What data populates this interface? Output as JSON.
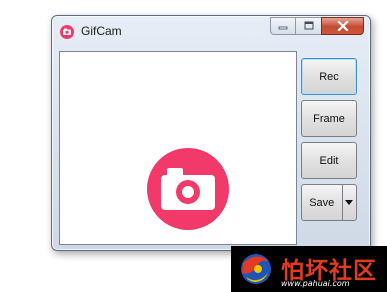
{
  "window": {
    "title": "GifCam",
    "icon": "gifcam-camera-icon",
    "accent_color": "#f23a6a",
    "controls": {
      "minimize_icon": "minimize-icon",
      "maximize_icon": "maximize-icon",
      "close_icon": "close-icon"
    }
  },
  "capture_area": {
    "logo_icon": "camera-icon",
    "logo_color": "#f23a6a"
  },
  "buttons": {
    "rec": "Rec",
    "frame": "Frame",
    "edit": "Edit",
    "save": "Save",
    "save_dropdown_icon": "triangle-down-icon"
  },
  "watermark": {
    "text": "怕坏社区",
    "url": "www.pahuai.com"
  }
}
